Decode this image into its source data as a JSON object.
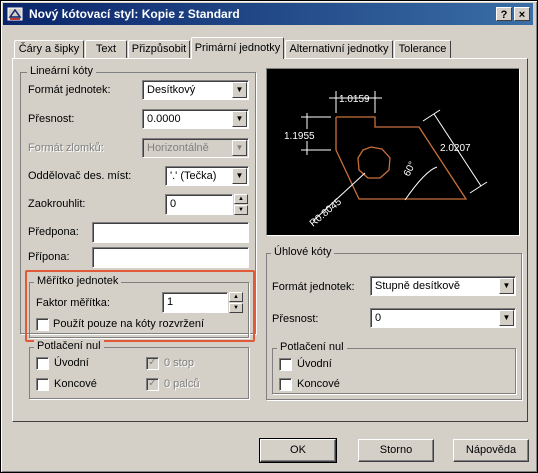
{
  "window": {
    "title": "Nový kótovací styl: Kopie z Standard",
    "help_button": "?",
    "close_button": "×"
  },
  "tabs": [
    {
      "label": "Čáry a šipky"
    },
    {
      "label": "Text"
    },
    {
      "label": "Přizpůsobit"
    },
    {
      "label": "Primární jednotky",
      "active": true
    },
    {
      "label": "Alternativní jednotky"
    },
    {
      "label": "Tolerance"
    }
  ],
  "linear": {
    "title": "Lineární kóty",
    "unit_format_label": "Formát jednotek:",
    "unit_format_value": "Desítkový",
    "precision_label": "Přesnost:",
    "precision_value": "0.0000",
    "fraction_format_label": "Formát zlomků:",
    "fraction_format_value": "Horizontálně",
    "decimal_sep_label": "Oddělovač des. míst:",
    "decimal_sep_value": "'.' (Tečka)",
    "round_label": "Zaokrouhlit:",
    "round_value": "0",
    "prefix_label": "Předpona:",
    "prefix_value": "",
    "suffix_label": "Přípona:",
    "suffix_value": ""
  },
  "scale": {
    "title": "Měřítko jednotek",
    "factor_label": "Faktor měřítka:",
    "factor_value": "1",
    "layout_only_label": "Použít pouze na kóty rozvržení",
    "layout_only_checked": false
  },
  "zero_suppression_linear": {
    "title": "Potlačení nul",
    "leading_label": "Úvodní",
    "trailing_label": "Koncové",
    "feet_label": "0 stop",
    "inches_label": "0  palců"
  },
  "preview": {
    "dim_top": "1.0159",
    "dim_left": "1.1955",
    "dim_right": "2.0207",
    "dim_angle": "60°",
    "dim_radius": "R0.8045"
  },
  "angular": {
    "title": "Úhlové kóty",
    "unit_format_label": "Formát jednotek:",
    "unit_format_value": "Stupně desítkově",
    "precision_label": "Přesnost:",
    "precision_value": "0"
  },
  "zero_suppression_angular": {
    "title": "Potlačení nul",
    "leading_label": "Úvodní",
    "trailing_label": "Koncové"
  },
  "buttons": {
    "ok": "OK",
    "cancel": "Storno",
    "help": "Nápověda"
  },
  "colors": {
    "title_bar": "#0a246a",
    "dialog_bg": "#d4d0c8",
    "preview_bg": "#000000",
    "preview_geometry": "#c8703a",
    "preview_dims": "#ffffff",
    "highlight_box": "#e05a3a"
  }
}
